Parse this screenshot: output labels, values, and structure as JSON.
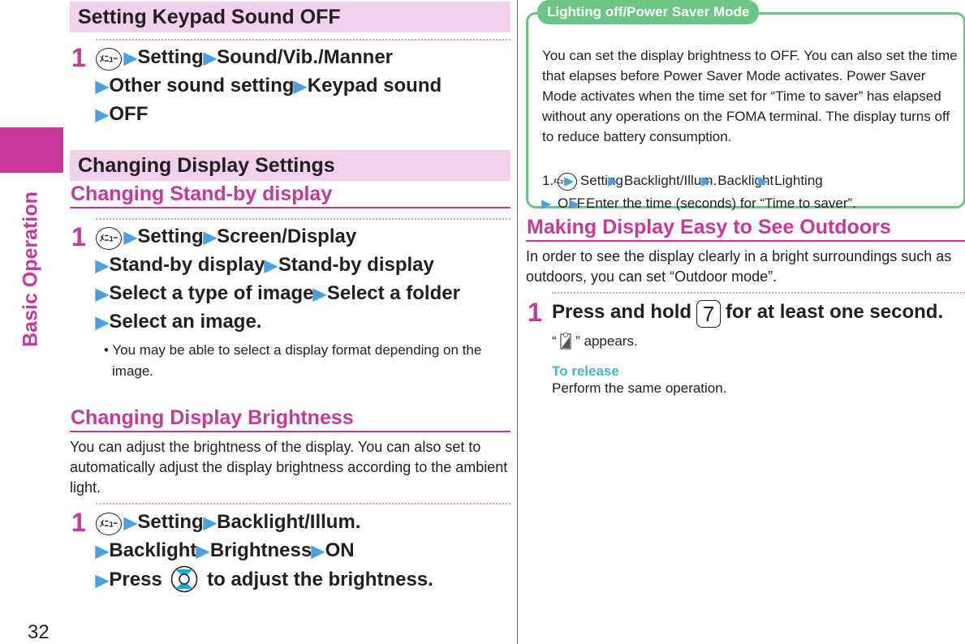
{
  "page": {
    "side_label": "Basic Operation",
    "page_number": "32",
    "colors": {
      "accent": "#c6389c",
      "banner_bg": "#f0d0ea",
      "arrow": "#4aa0e0",
      "info_green": "#6cc585",
      "release": "#3bb8d0"
    }
  },
  "icons": {
    "menu_key": "menu-key-icon",
    "arrow": "blue-triangle-arrow-icon",
    "nav_key": "navigation-key-icon",
    "num_key_7": "key-7-icon",
    "outdoor_mode": "outdoor-mode-icon"
  },
  "left": {
    "keypad": {
      "banner": "Setting Keypad Sound OFF",
      "step_num": "1",
      "menu_key_label": "ﾒﾆｭｰ",
      "path": [
        "Setting",
        "Sound/Vib./Manner",
        "Other sound setting",
        "Keypad sound",
        "OFF"
      ]
    },
    "display": {
      "banner": "Changing Display Settings",
      "standby": {
        "heading": "Changing Stand-by display",
        "step_num": "1",
        "path": [
          "Setting",
          "Screen/Display",
          "Stand-by display",
          "Stand-by display",
          "Select a type of image",
          "Select a folder",
          "Select an image."
        ],
        "note": "• You may be able to select a display format depending on the image."
      },
      "brightness": {
        "heading": "Changing Display Brightness",
        "desc": "You can adjust the brightness of the display. You can also set to automatically adjust the display brightness according to the ambient light.",
        "step_num": "1",
        "path": [
          "Setting",
          "Backlight/Illum.",
          "Backlight",
          "Brightness",
          "ON",
          "Press"
        ],
        "tail": "to adjust the brightness."
      }
    }
  },
  "right": {
    "info": {
      "title": "Lighting off/Power Saver Mode",
      "text": "You can set the display brightness to OFF. You can also set the time that elapses before Power Saver Mode activates. Power Saver Mode activates when the time set for “Time to saver” has elapsed without any operations on the FOMA terminal. The display turns off to reduce battery consumption.",
      "step_prefix": "1.",
      "path": [
        "Setting",
        "Backlight/Illum.",
        "Backlight",
        "Lighting",
        "OFF",
        "Enter the time (seconds) for “Time to saver”."
      ]
    },
    "outdoor": {
      "heading": "Making Display Easy to See Outdoors",
      "desc": "In order to see the display clearly in a bright surroundings such as outdoors, you can set “Outdoor mode”.",
      "step_num": "1",
      "step_pre": "Press and hold",
      "key_label": "7",
      "step_post": "for at least one second.",
      "appears_open": "“",
      "appears_close": "” appears.",
      "release_label": "To release",
      "release_text": "Perform the same operation."
    }
  }
}
